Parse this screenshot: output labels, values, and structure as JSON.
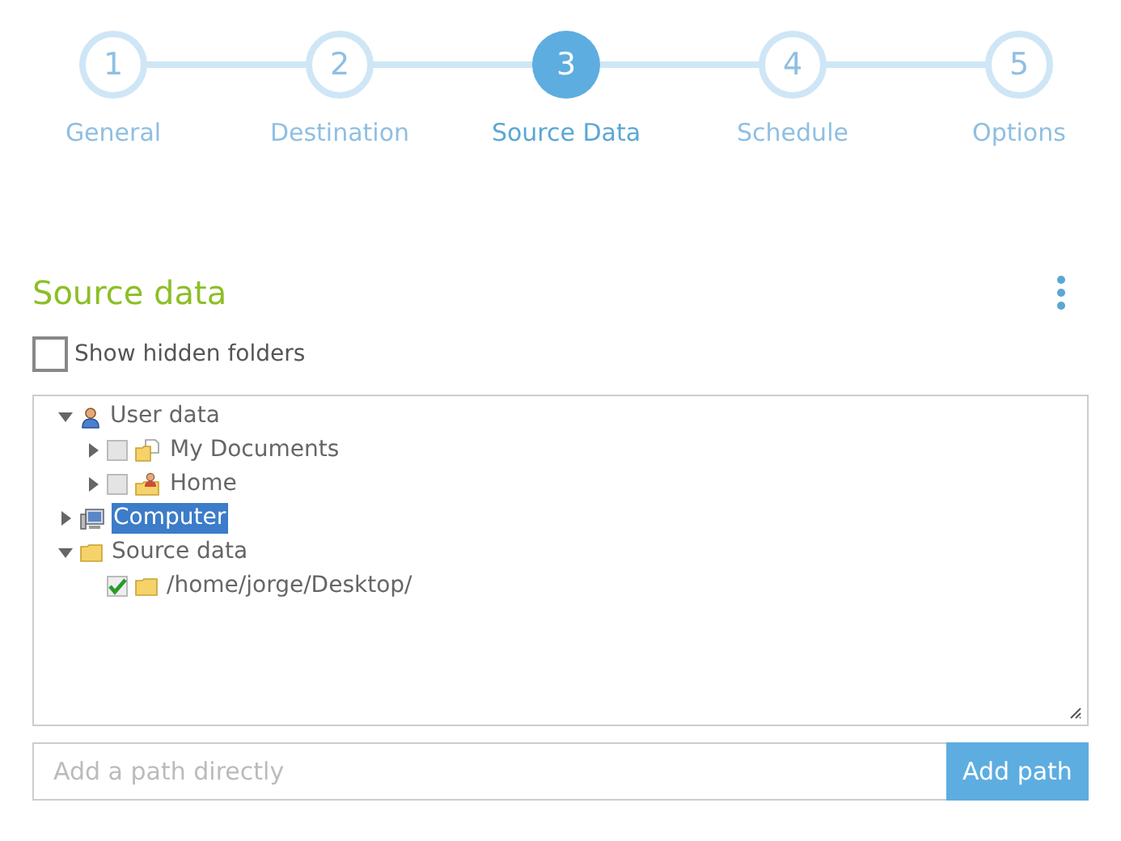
{
  "steps": [
    {
      "number": "1",
      "label": "General",
      "selected": false
    },
    {
      "number": "2",
      "label": "Destination",
      "selected": false
    },
    {
      "number": "3",
      "label": "Source Data",
      "selected": true
    },
    {
      "number": "4",
      "label": "Schedule",
      "selected": false
    },
    {
      "number": "5",
      "label": "Options",
      "selected": false
    }
  ],
  "section": {
    "title": "Source data"
  },
  "show_hidden": {
    "label": "Show hidden folders",
    "checked": false
  },
  "tree": [
    {
      "label": "User data",
      "kind": "user",
      "expanded": true,
      "selected": false,
      "children": [
        {
          "label": "My Documents",
          "kind": "documents",
          "expanded": false,
          "checked": false,
          "selected": false
        },
        {
          "label": "Home",
          "kind": "home",
          "expanded": false,
          "checked": false,
          "selected": false
        }
      ]
    },
    {
      "label": "Computer",
      "kind": "computer",
      "expanded": false,
      "selected": true
    },
    {
      "label": "Source data",
      "kind": "folder",
      "expanded": true,
      "selected": false,
      "children": [
        {
          "label": "/home/jorge/Desktop/",
          "kind": "folder",
          "checked": true,
          "selected": false
        }
      ]
    }
  ],
  "path_input": {
    "placeholder": "Add a path directly"
  },
  "add_button": "Add path"
}
